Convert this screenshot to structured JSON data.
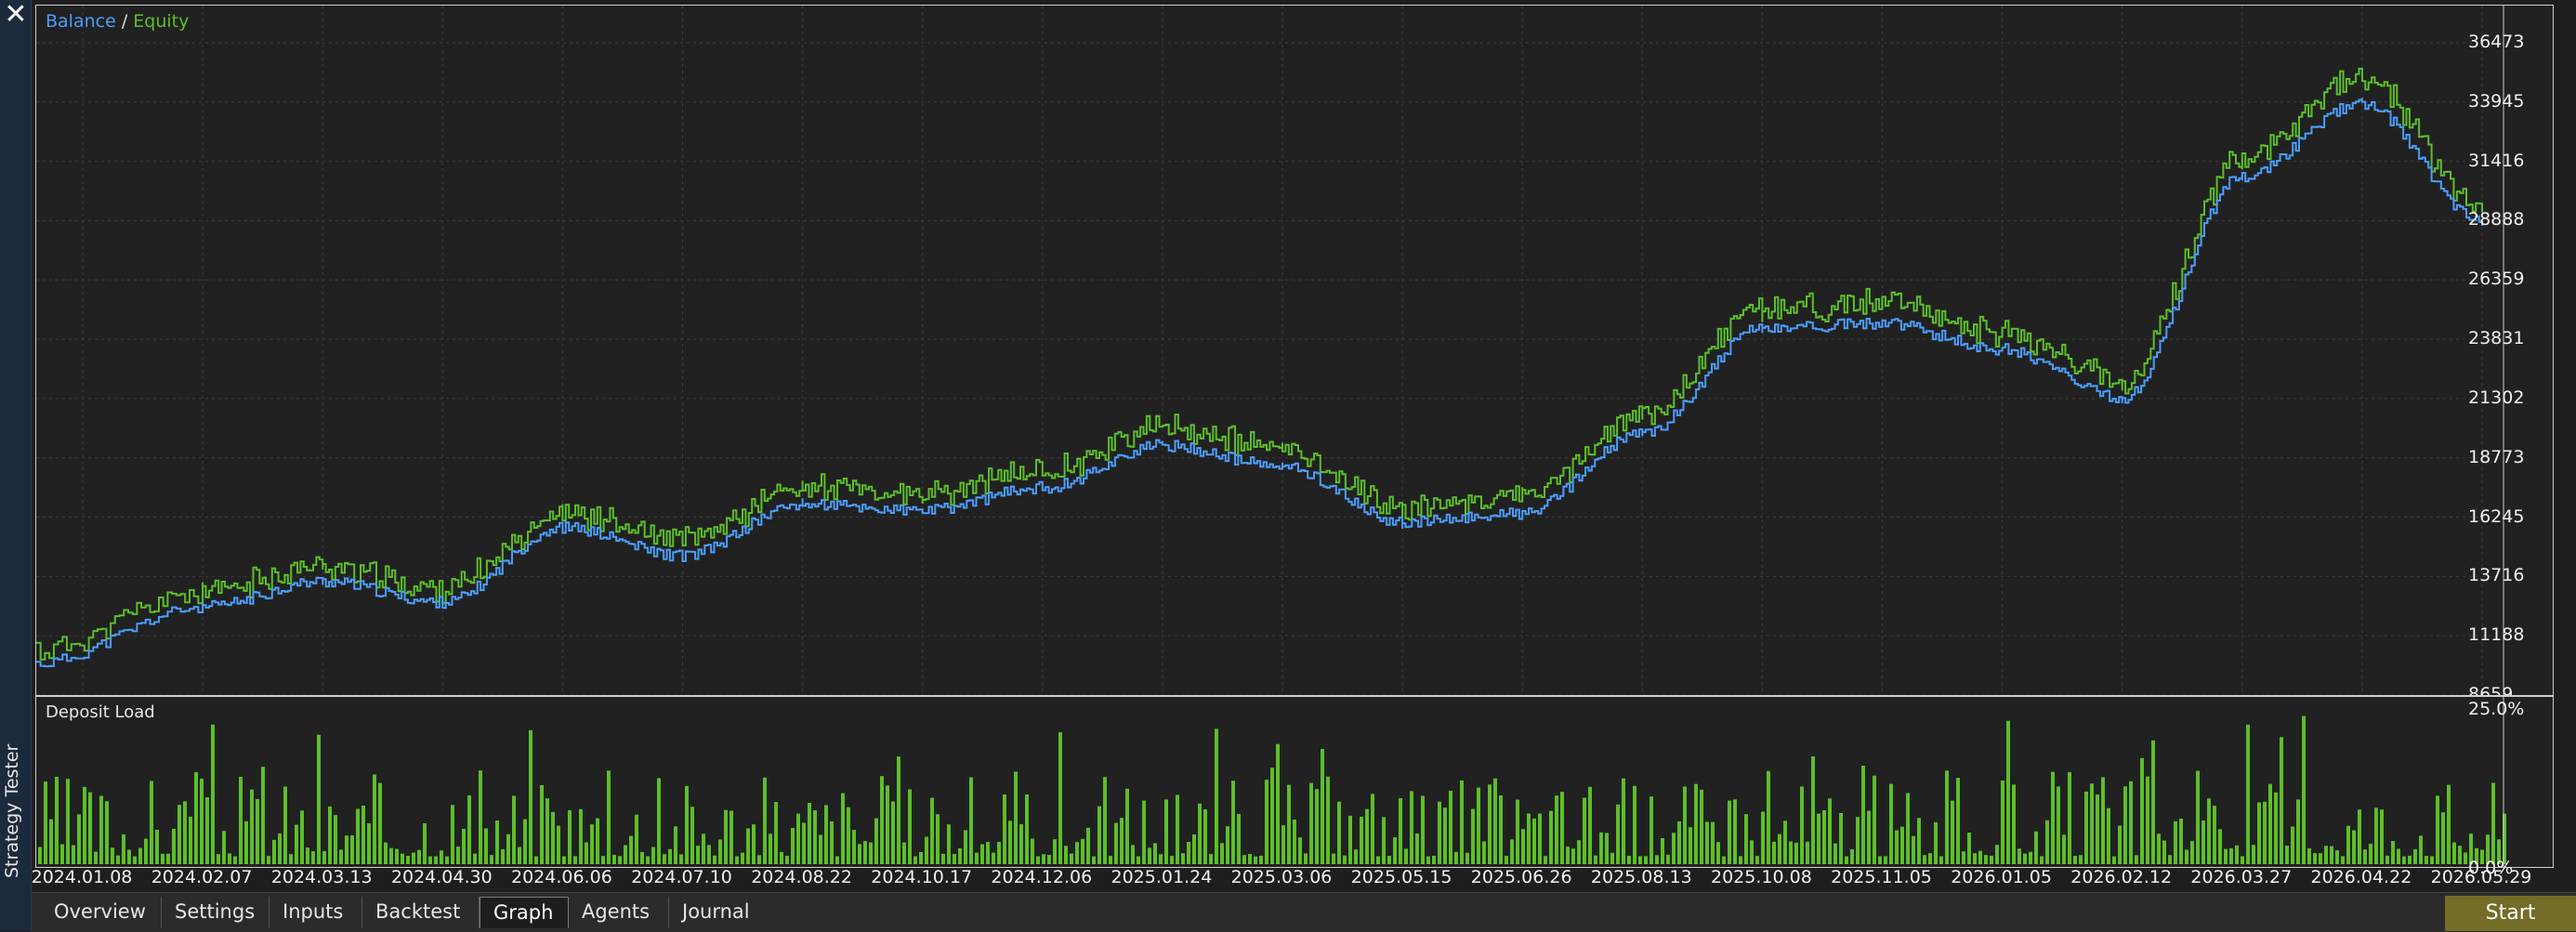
{
  "window": {
    "close_glyph": "✕",
    "vertical_title": "Strategy Tester"
  },
  "balance_chart": {
    "legend_balance": "Balance",
    "legend_separator": "/",
    "legend_equity": "Equity",
    "balance_color": "#4a9eff",
    "equity_color": "#5cbf2a",
    "y_ticks": [
      "36473",
      "33945",
      "31416",
      "28888",
      "26359",
      "23831",
      "21302",
      "18773",
      "16245",
      "13716",
      "11188",
      "8659"
    ]
  },
  "deposit_load": {
    "title": "Deposit Load",
    "y_max_label": "25.0%",
    "y_min_label": "0.0%",
    "bar_color": "#5cbf2a"
  },
  "x_axis": {
    "ticks": [
      "2024.01.08",
      "2024.02.07",
      "2024.03.13",
      "2024.04.30",
      "2024.06.06",
      "2024.07.10",
      "2024.08.22",
      "2024.10.17",
      "2024.12.06",
      "2025.01.24",
      "2025.03.06",
      "2025.05.15",
      "2025.06.26",
      "2025.08.13",
      "2025.10.08",
      "2025.11.05",
      "2026.01.05",
      "2026.02.12",
      "2026.03.27",
      "2026.04.22",
      "2026.05.29"
    ]
  },
  "chart_data": {
    "type": "line",
    "title": "",
    "xlabel": "",
    "ylabel": "",
    "ylim": [
      8659,
      36473
    ],
    "grid": true,
    "legend_position": "top-left",
    "x": [
      "2024.01.08",
      "2024.02.07",
      "2024.03.13",
      "2024.04.30",
      "2024.06.06",
      "2024.07.10",
      "2024.08.22",
      "2024.10.17",
      "2024.12.06",
      "2025.01.24",
      "2025.03.06",
      "2025.05.15",
      "2025.06.26",
      "2025.08.13",
      "2025.10.08",
      "2025.11.05",
      "2026.01.05",
      "2026.02.12",
      "2026.03.27",
      "2026.04.22",
      "2026.05.29"
    ],
    "series": [
      {
        "name": "Balance",
        "color": "#4a9eff",
        "values": [
          10000,
          12400,
          13500,
          12600,
          15800,
          14600,
          16800,
          16500,
          17500,
          19300,
          18400,
          16000,
          16400,
          19800,
          24300,
          24500,
          23400,
          21300,
          30800,
          33900,
          28900
        ]
      },
      {
        "name": "Equity",
        "color": "#5cbf2a",
        "values": [
          10300,
          12800,
          13900,
          12900,
          16200,
          15000,
          17300,
          16900,
          18000,
          19800,
          18900,
          16400,
          16900,
          20300,
          24900,
          25100,
          23900,
          21800,
          31300,
          34700,
          29300
        ]
      }
    ]
  },
  "tabs": [
    {
      "label": "Overview",
      "active": false
    },
    {
      "label": "Settings",
      "active": false
    },
    {
      "label": "Inputs",
      "active": false
    },
    {
      "label": "Backtest",
      "active": false
    },
    {
      "label": "Graph",
      "active": true
    },
    {
      "label": "Agents",
      "active": false
    },
    {
      "label": "Journal",
      "active": false
    }
  ],
  "start_button": {
    "label": "Start",
    "color": "#736d27"
  }
}
